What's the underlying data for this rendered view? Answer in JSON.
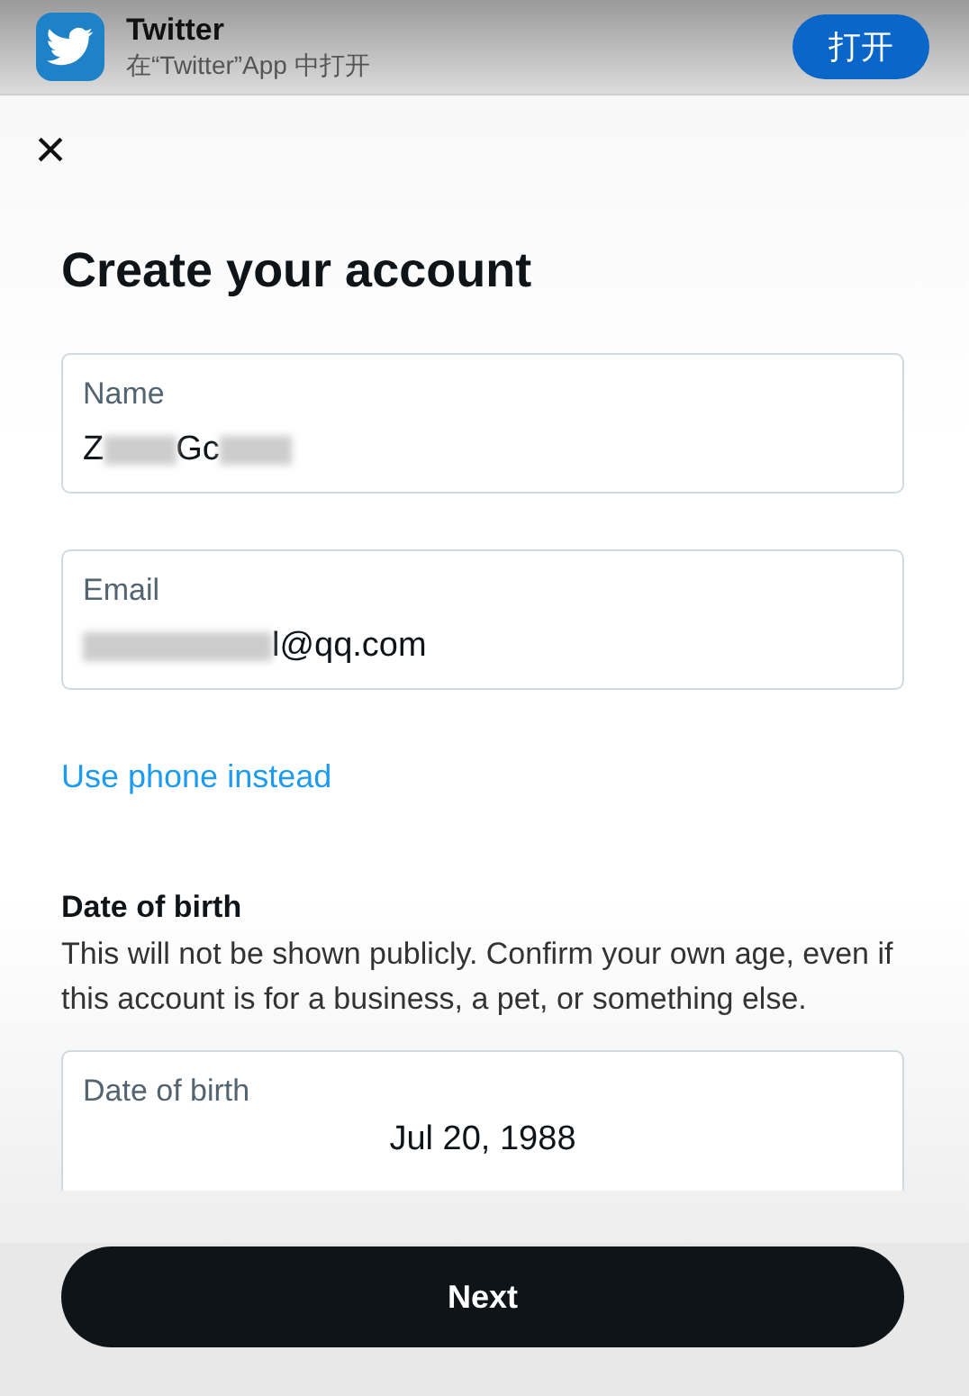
{
  "app_banner": {
    "app_name": "Twitter",
    "subtitle": "在“Twitter”App 中打开",
    "open_button": "打开"
  },
  "close_button": "×",
  "title": "Create your account",
  "fields": [
    {
      "label": "Name",
      "value_parts": [
        {
          "kind": "text",
          "text": "Z"
        },
        {
          "kind": "redacted"
        },
        {
          "kind": "text",
          "text": "Gc"
        },
        {
          "kind": "redacted"
        }
      ]
    },
    {
      "label": "Email",
      "value_parts": [
        {
          "kind": "redacted"
        },
        {
          "kind": "text",
          "text": "l@qq.com"
        }
      ]
    }
  ],
  "switch_link": "Use phone instead",
  "date_of_birth": {
    "heading": "Date of birth",
    "note": "This will not be shown publicly. Confirm your own age, even if this account is for a business, a pet, or something else.",
    "field_label": "Date of birth",
    "value": "Jul 20, 1988"
  },
  "next_button": "Next"
}
